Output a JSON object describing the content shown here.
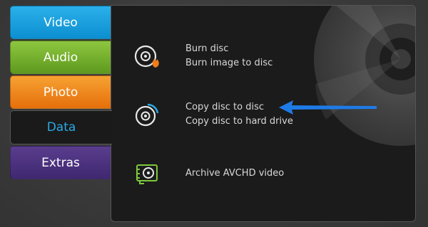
{
  "tabs": {
    "video": "Video",
    "audio": "Audio",
    "photo": "Photo",
    "data": "Data",
    "extras": "Extras"
  },
  "panel": {
    "burn": {
      "icon": "burn-disc-icon",
      "options": [
        "Burn disc",
        "Burn image to disc"
      ]
    },
    "copy": {
      "icon": "copy-disc-icon",
      "options": [
        "Copy disc to disc",
        "Copy disc to hard drive"
      ]
    },
    "archive": {
      "icon": "archive-avchd-icon",
      "options": [
        "Archive AVCHD video"
      ]
    }
  },
  "colors": {
    "accent_blue": "#29a9e6",
    "burn_flame": "#f07d1a",
    "archive_green": "#7dc83c",
    "annotation_arrow": "#1e7be6"
  }
}
